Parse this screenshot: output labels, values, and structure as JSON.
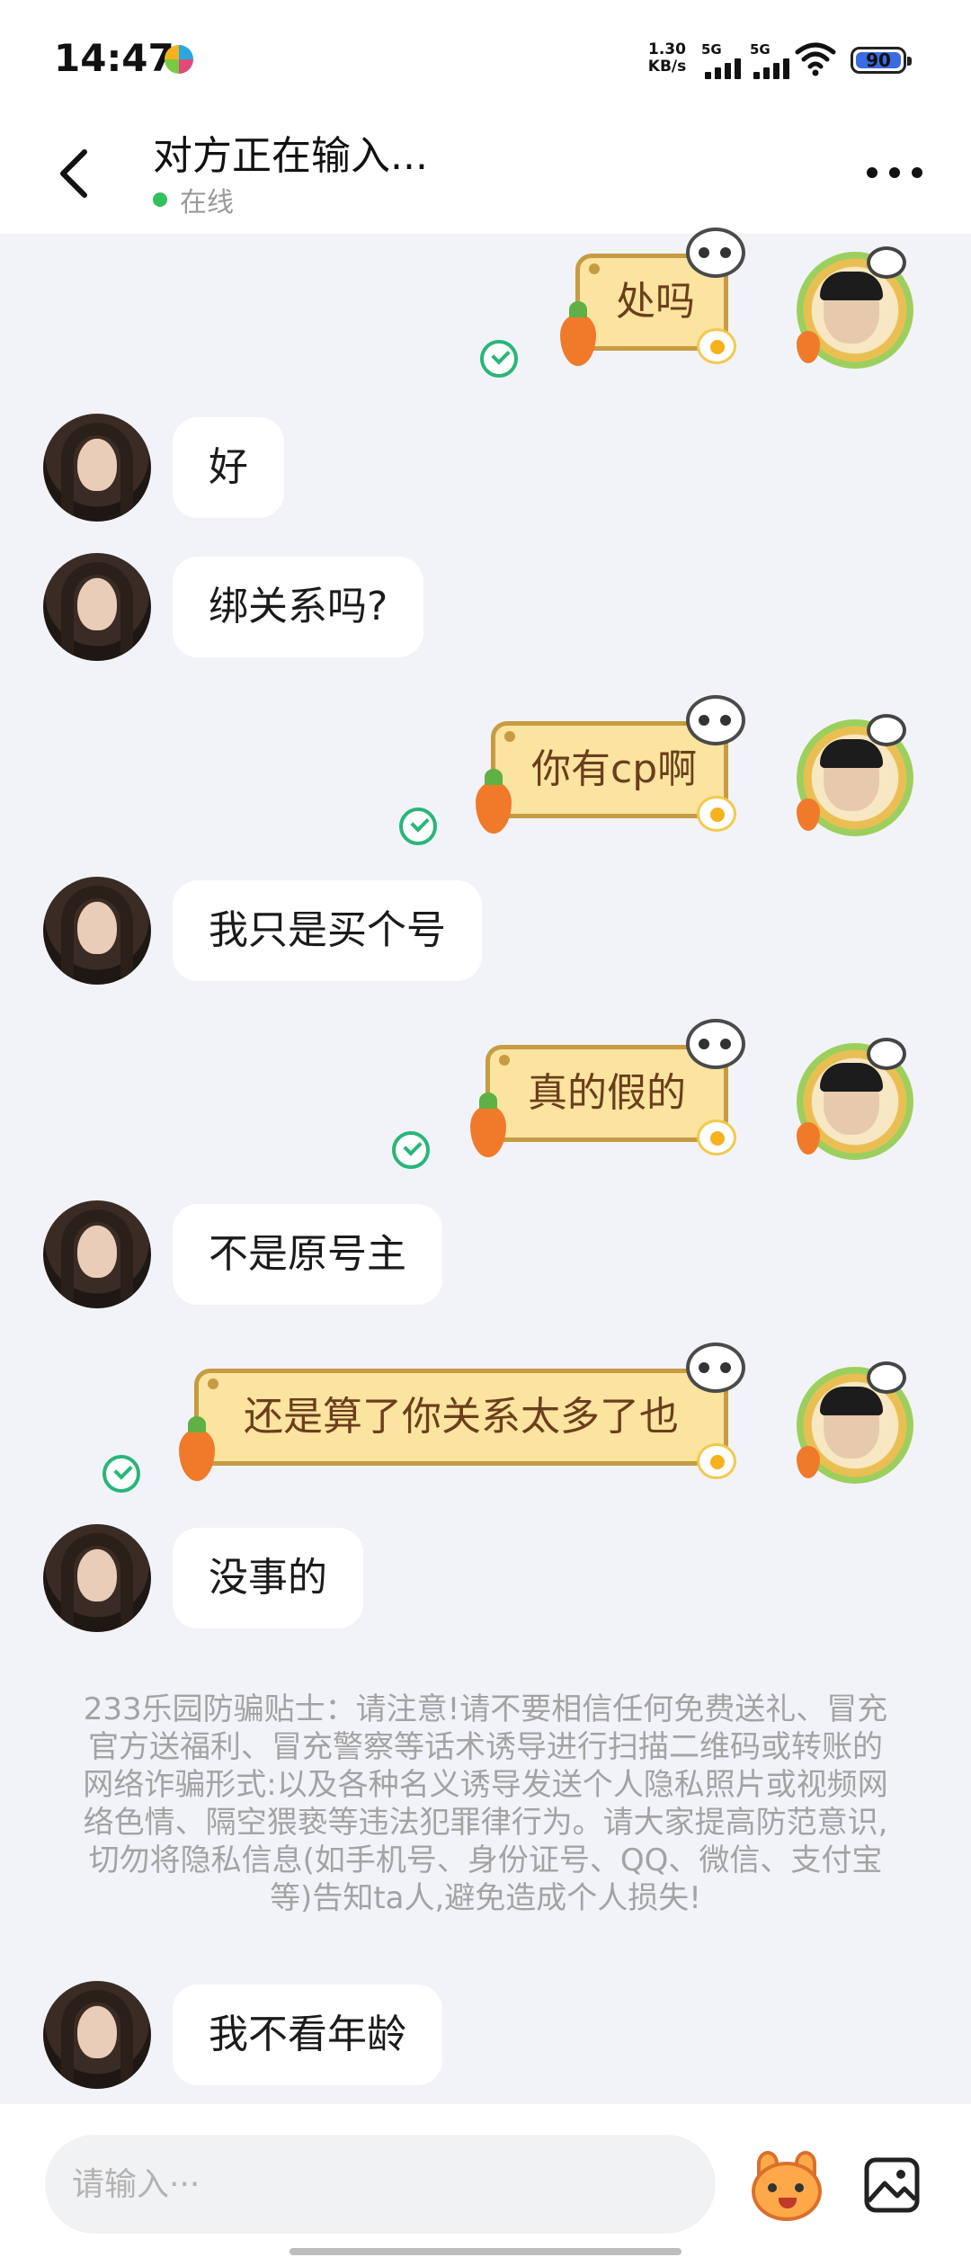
{
  "status_bar": {
    "time": "14:47",
    "net_speed_value": "1.30",
    "net_speed_unit": "KB/s",
    "signal_1_label": "5G",
    "signal_2_label": "5G",
    "battery": "90",
    "battery_color": "#3a6be0"
  },
  "header": {
    "title": "对方正在输入...",
    "status": "在线",
    "status_color": "#2fc15a",
    "back_icon": "chevron-left-icon",
    "more_icon": "more-horizontal-icon"
  },
  "messages": [
    {
      "side": "right",
      "text": "处吗",
      "read": true
    },
    {
      "side": "left",
      "text": "好"
    },
    {
      "side": "left",
      "text": "绑关系吗?"
    },
    {
      "side": "right",
      "text": "你有cp啊",
      "read": true
    },
    {
      "side": "left",
      "text": "我只是买个号"
    },
    {
      "side": "right",
      "text": "真的假的",
      "read": true
    },
    {
      "side": "left",
      "text": "不是原号主"
    },
    {
      "side": "right",
      "text": "还是算了你关系太多了也",
      "read": true
    },
    {
      "side": "left",
      "text": "没事的"
    },
    {
      "side": "left",
      "text": "我不看年龄"
    }
  ],
  "notice": "233乐园防骗贴士：请注意!请不要相信任何免费送礼、冒充官方送福利、冒充警察等话术诱导进行扫描二维码或转账的网络诈骗形式:以及各种名义诱导发送个人隐私照片或视频网络色情、隔空猥亵等违法犯罪律行为。请大家提高防范意识,切勿将隐私信息(如手机号、身份证号、QQ、微信、支付宝等)告知ta人,避免造成个人损失!",
  "input": {
    "placeholder": "请输入···",
    "emoji_icon": "emoji-sticker-icon",
    "gallery_icon": "image-gallery-icon"
  },
  "colors": {
    "background": "#f1f3f8",
    "bubble_left": "#ffffff",
    "bubble_right": "#fbe3a0",
    "bubble_right_border": "#c79b43",
    "bubble_right_text": "#6b3e1c",
    "read_check": "#2bb57a",
    "notice_text": "#a3a3a3"
  }
}
